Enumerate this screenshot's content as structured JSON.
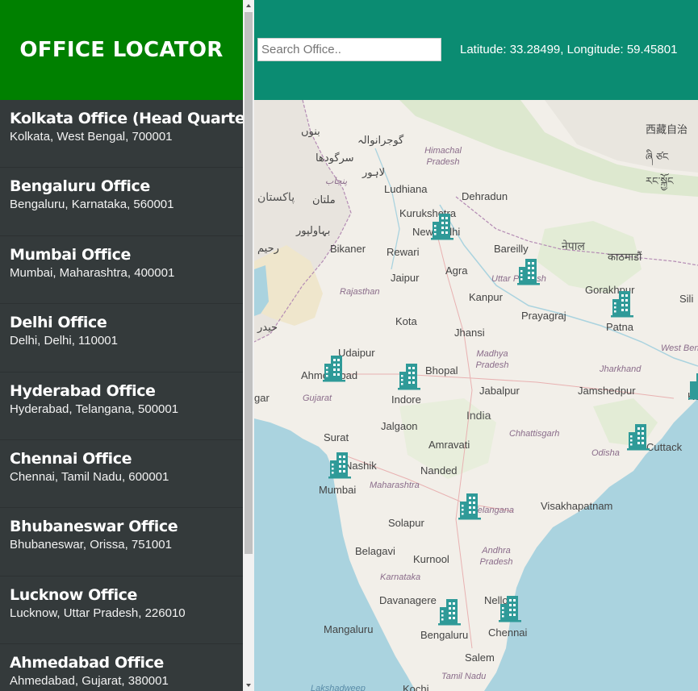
{
  "app": {
    "title": "OFFICE LOCATOR"
  },
  "search": {
    "placeholder": "Search Office..",
    "value": ""
  },
  "coordinates": {
    "text": "Latitude: 33.28499, Longitude: 59.45801"
  },
  "offices": [
    {
      "name": "Kolkata Office (Head Quarters)",
      "address": "Kolkata, West Bengal, 700001"
    },
    {
      "name": "Bengaluru Office",
      "address": "Bengaluru, Karnataka, 560001"
    },
    {
      "name": "Mumbai Office",
      "address": "Mumbai, Maharashtra, 400001"
    },
    {
      "name": "Delhi Office",
      "address": "Delhi, Delhi, 110001"
    },
    {
      "name": "Hyderabad Office",
      "address": "Hyderabad, Telangana, 500001"
    },
    {
      "name": "Chennai Office",
      "address": "Chennai, Tamil Nadu, 600001"
    },
    {
      "name": "Bhubaneswar Office",
      "address": "Bhubaneswar, Orissa, 751001"
    },
    {
      "name": "Lucknow Office",
      "address": "Lucknow, Uttar Pradesh, 226010"
    },
    {
      "name": "Ahmedabad Office",
      "address": "Ahmedabad, Gujarat, 380001"
    }
  ],
  "map": {
    "labels": {
      "western_china": "西藏自治",
      "tibetan": "ཞི ཙང",
      "tibetan_2": "རང་སྐྱོང",
      "urdu_1": "بنوں",
      "urdu_2": "گوجرانوالہ",
      "urdu_3": "سرگودھا",
      "urdu_4": "پنجاب",
      "urdu_5": "لاہور",
      "urdu_6": "پاکستان",
      "urdu_7": "ملتان",
      "urdu_8": "بہاولپور",
      "urdu_9": "رحیم",
      "urdu_10": "حیدر",
      "himachal": "Himachal Pradesh",
      "ludhiana": "Ludhiana",
      "dehradun": "Dehradun",
      "kurukshetra": "Kurukshetra",
      "new_delhi": "New Delhi",
      "bikaner": "Bikaner",
      "rewari": "Rewari",
      "bareilly": "Bareilly",
      "nepal": "नेपाल",
      "kathmandu": "काठमाडौं",
      "rajasthan": "Rajasthan",
      "jaipur": "Jaipur",
      "agra": "Agra",
      "uttar_pradesh": "Uttar Pradesh",
      "gorakhpur": "Gorakhpur",
      "sili": "Sili",
      "kanpur": "Kanpur",
      "prayagraj": "Prayagraj",
      "patna": "Patna",
      "kota": "Kota",
      "jhansi": "Jhansi",
      "west_bengal": "West Ben",
      "udaipur": "Udaipur",
      "madhya_pradesh": "Madhya Pradesh",
      "jharkhand": "Jharkhand",
      "ahmedabad": "Ahmedabad",
      "bhopal": "Bhopal",
      "gar": "gar",
      "gujarat": "Gujarat",
      "indore": "Indore",
      "jabalpur": "Jabalpur",
      "jamshedpur": "Jamshedpur",
      "kol": "Ko",
      "india": "India",
      "jalgaon": "Jalgaon",
      "chhattisgarh": "Chhattisgarh",
      "surat": "Surat",
      "amravati": "Amravati",
      "cuttack": "Cuttack",
      "odisha": "Odisha",
      "nashik": "Nashik",
      "nanded": "Nanded",
      "mumbai": "Mumbai",
      "maharashtra": "Maharashtra",
      "telangana": "Telangana",
      "visakhapatnam": "Visakhapatnam",
      "solapur": "Solapur",
      "belagavi": "Belagavi",
      "kurnool": "Kurnool",
      "andhra": "Andhra Pradesh",
      "karnataka": "Karnataka",
      "davanagere": "Davanagere",
      "nellore": "Nellore",
      "mangaluru": "Mangaluru",
      "bengaluru": "Bengaluru",
      "chennai": "Chennai",
      "salem": "Salem",
      "tamil_nadu": "Tamil Nadu",
      "lakshadweep": "Lakshadweep",
      "kochi": "Kochi"
    }
  },
  "colors": {
    "brand_green": "#008000",
    "header_teal": "#0b8c72",
    "sidebar_bg": "#343a3b",
    "marker_teal": "#2f9a98",
    "sea": "#aad3df",
    "land": "#f2efe9"
  },
  "icons": {
    "marker": "office-building-icon"
  }
}
